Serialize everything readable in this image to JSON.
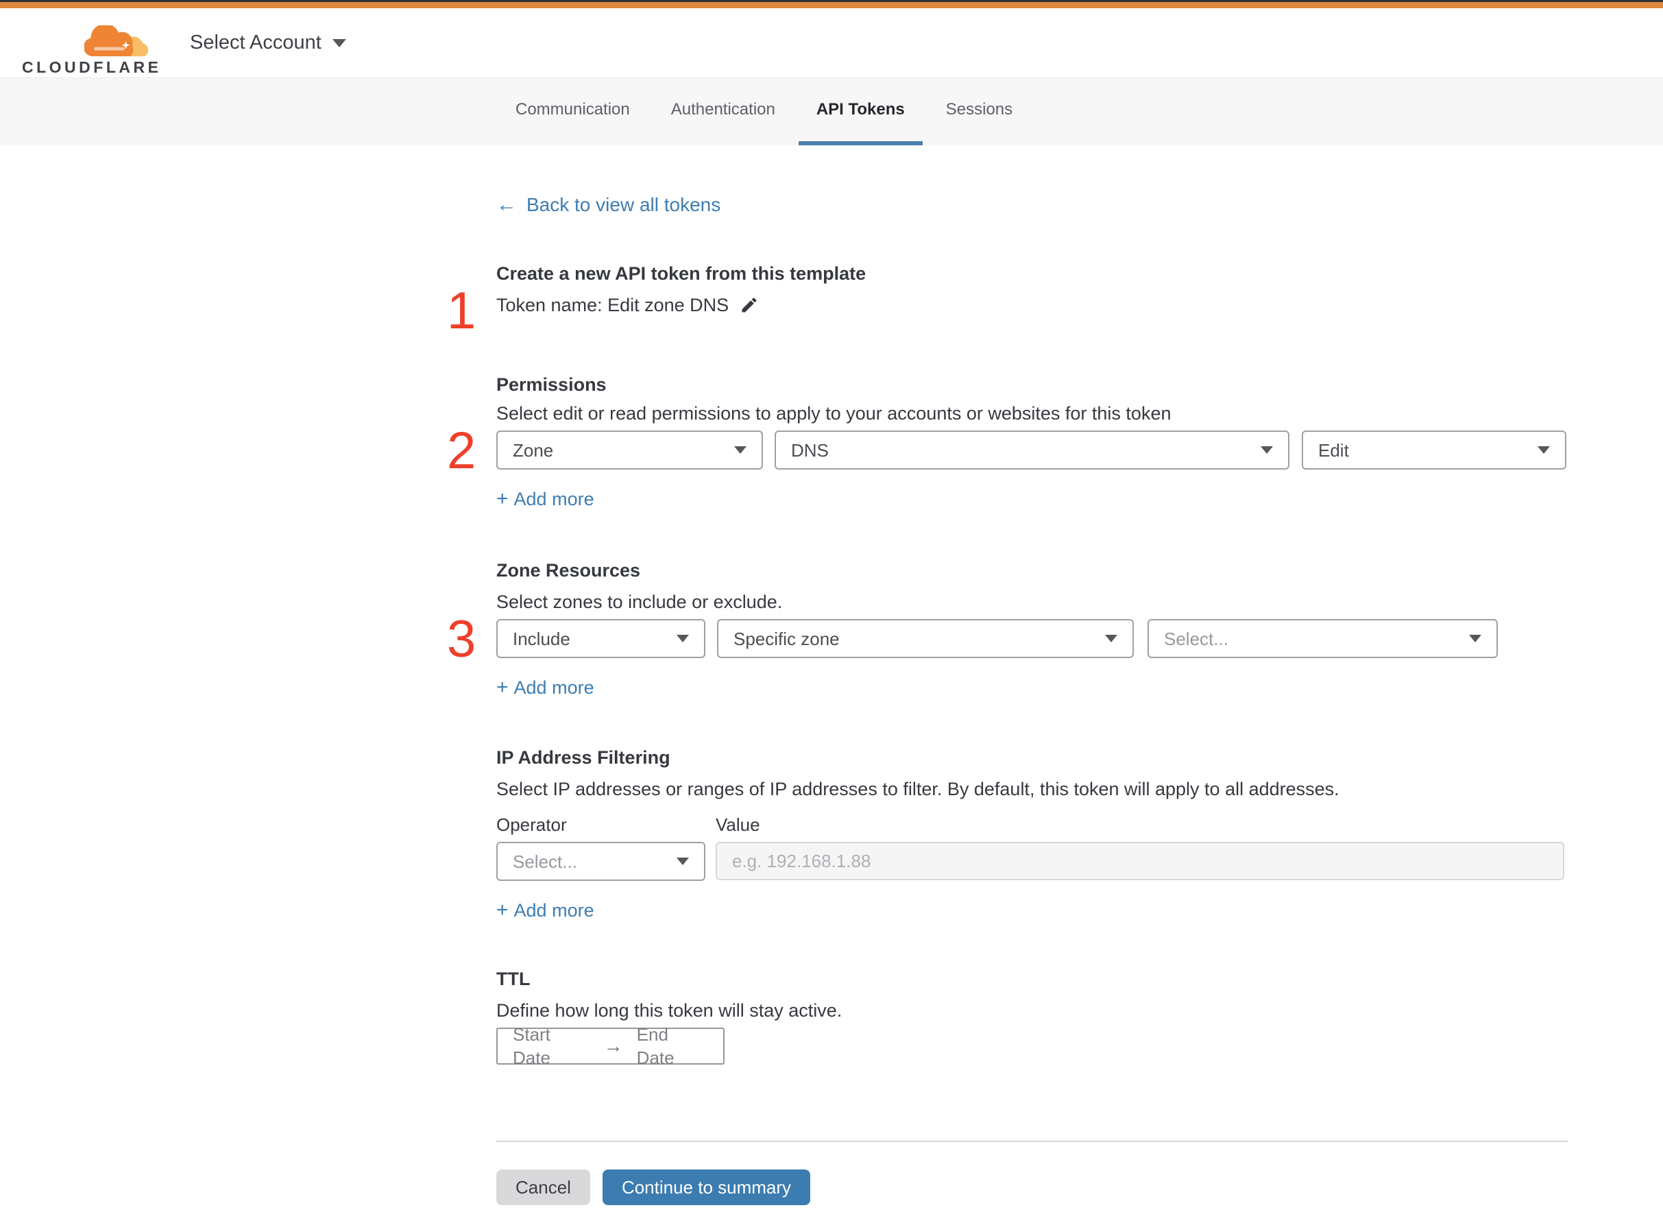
{
  "colors": {
    "brand-orange": "#DE873C",
    "accent-blue": "#4B80AD",
    "link-blue": "#3E7CB1",
    "button-blue": "#3C7CB0",
    "annotation-red": "#EE3F2B",
    "logo-orange": "#EE8434",
    "logo-orange-light": "#F9BE63"
  },
  "header": {
    "logo_text": "CLOUDFLARE",
    "account_selector_label": "Select Account"
  },
  "tabs": {
    "items": [
      {
        "label": "Communication",
        "active": false
      },
      {
        "label": "Authentication",
        "active": false
      },
      {
        "label": "API Tokens",
        "active": true
      },
      {
        "label": "Sessions",
        "active": false
      }
    ]
  },
  "page": {
    "back_arrow": "←",
    "back_link_label": "Back to view all tokens"
  },
  "common": {
    "plus": "+",
    "add_more_label": "Add more"
  },
  "intro": {
    "step_number": "1",
    "title": "Create a new API token from this template",
    "token_name_line": "Token name: Edit zone DNS"
  },
  "permissions": {
    "step_number": "2",
    "title": "Permissions",
    "description": "Select edit or read permissions to apply to your accounts or websites for this token",
    "scope_value": "Zone",
    "category_value": "DNS",
    "access_value": "Edit"
  },
  "zone_resources": {
    "step_number": "3",
    "title": "Zone Resources",
    "description": "Select zones to include or exclude.",
    "mode_value": "Include",
    "scope_value": "Specific zone",
    "zone_placeholder": "Select..."
  },
  "ip_filtering": {
    "title": "IP Address Filtering",
    "description": "Select IP addresses or ranges of IP addresses to filter. By default, this token will apply to all addresses.",
    "operator_label": "Operator",
    "value_label": "Value",
    "operator_placeholder": "Select...",
    "value_placeholder": "e.g. 192.168.1.88"
  },
  "ttl": {
    "title": "TTL",
    "description": "Define how long this token will stay active.",
    "start_label": "Start Date",
    "arrow": "→",
    "end_label": "End Date"
  },
  "footer": {
    "cancel_label": "Cancel",
    "continue_label": "Continue to summary"
  }
}
